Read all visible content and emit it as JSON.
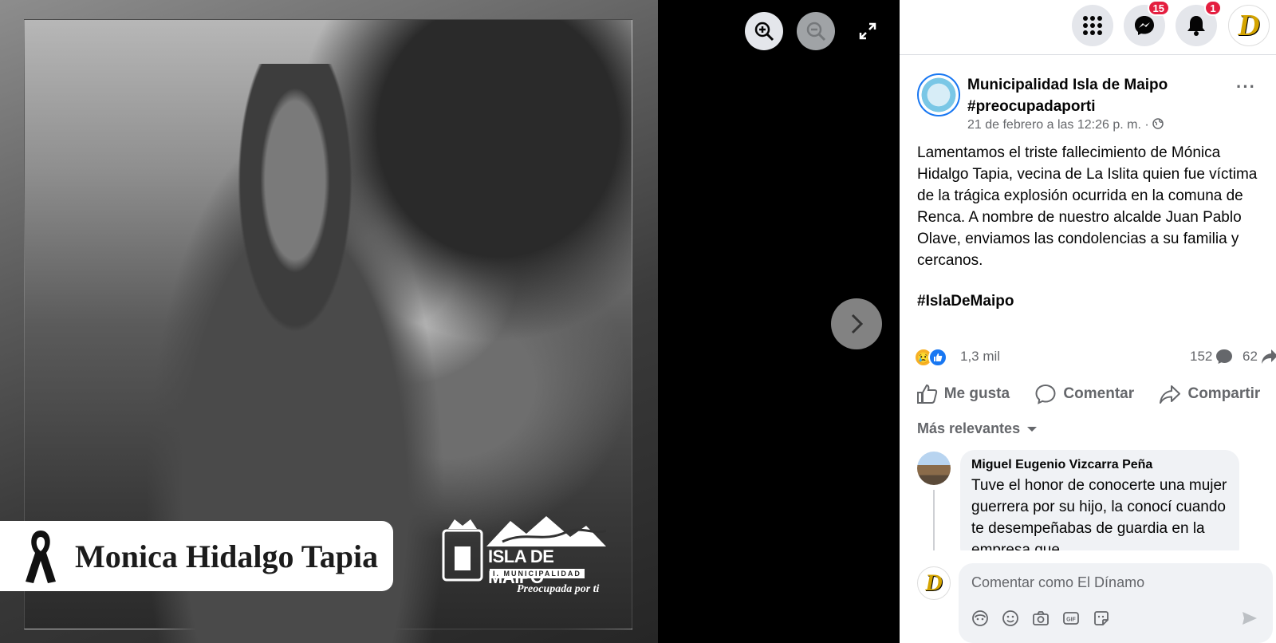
{
  "photo": {
    "person_name": "Monica Hidalgo Tapia",
    "logo_brand": "ISLA DE MAIPO",
    "logo_sub": "I. MUNICIPALIDAD",
    "logo_slogan": "Preocupada por ti"
  },
  "viewer_controls": {
    "zoom_in": "zoom-in-icon",
    "zoom_out": "zoom-out-icon",
    "fullscreen": "fullscreen-icon",
    "next": "chevron-right-icon"
  },
  "topbar": {
    "messenger_badge": "15",
    "notifications_badge": "1",
    "avatar_letter": "D"
  },
  "post": {
    "page_name": "Municipalidad Isla de Maipo #preocupadaporti",
    "date": "21 de febrero a las 12:26 p. m. · ",
    "more": "···",
    "text": "Lamentamos el triste fallecimiento de Mónica Hidalgo Tapia, vecina de La Islita quien fue víctima de la trágica explosión ocurrida en la comuna de Renca. A nombre de nuestro alcalde Juan Pablo Olave, enviamos las condolencias a su familia y cercanos.",
    "hashtag": "#IslaDeMaipo",
    "reaction_count": "1,3 mil",
    "comment_count": "152",
    "share_count": "62"
  },
  "actions": {
    "like": "Me gusta",
    "comment": "Comentar",
    "share": "Compartir"
  },
  "comments": {
    "sort_label": "Más relevantes",
    "first": {
      "author": "Miguel Eugenio Vizcarra Peña",
      "text": "Tuve el honor de conocerte una mujer guerrera por su hijo, la conocí cuando te desempeñabas de guardia en la empresa que"
    }
  },
  "composer": {
    "placeholder": "Comentar como El Dínamo"
  },
  "colors": {
    "facebook_blue": "#1877f2",
    "badge_red": "#e41e3f",
    "secondary_text": "#65676b"
  }
}
